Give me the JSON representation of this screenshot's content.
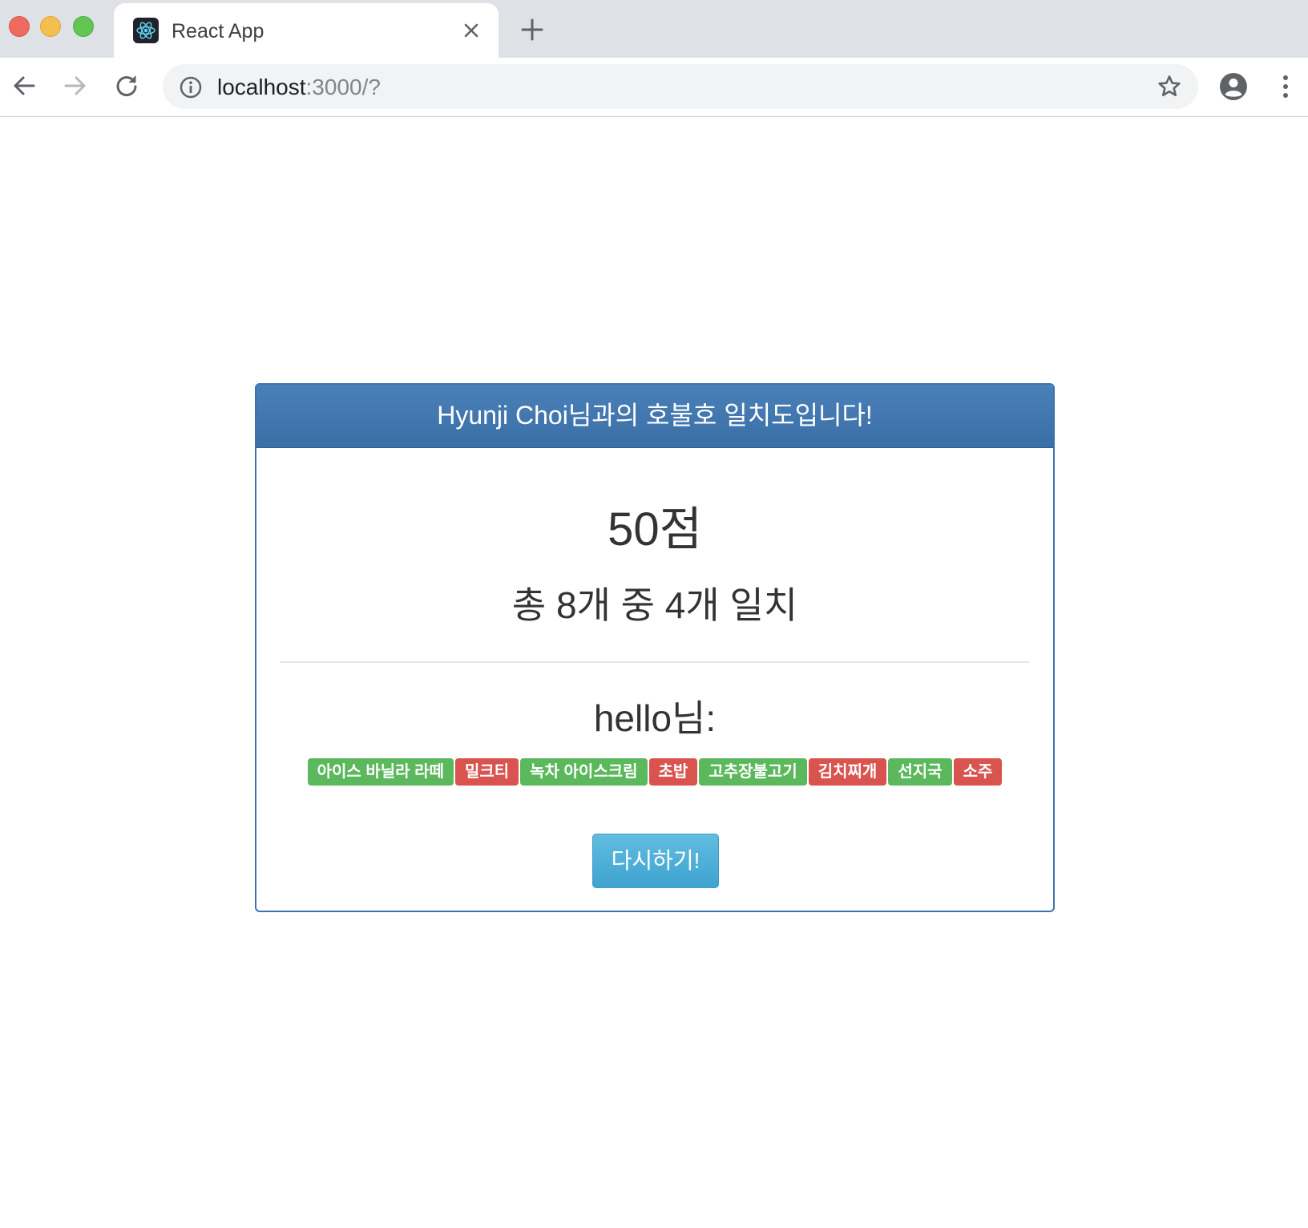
{
  "browser": {
    "tab_title": "React App",
    "url_host": "localhost",
    "url_rest": ":3000/?",
    "icons": {
      "favicon": "react-logo-icon",
      "tab_close": "close-icon",
      "new_tab": "plus-icon",
      "back": "arrow-left-icon",
      "forward": "arrow-right-icon",
      "reload": "reload-icon",
      "site_info": "info-icon",
      "bookmark": "star-icon",
      "profile": "account-icon",
      "menu": "more-vert-icon"
    }
  },
  "result": {
    "heading": "Hyunji Choi님과의 호불호 일치도입니다!",
    "score": "50점",
    "summary": "총 8개 중 4개 일치",
    "friend_label": "hello님:",
    "items": [
      {
        "text": "아이스 바닐라 라떼",
        "matched": true
      },
      {
        "text": "밀크티",
        "matched": false
      },
      {
        "text": "녹차 아이스크림",
        "matched": true
      },
      {
        "text": "초밥",
        "matched": false
      },
      {
        "text": "고추장불고기",
        "matched": true
      },
      {
        "text": "김치찌개",
        "matched": false
      },
      {
        "text": "선지국",
        "matched": true
      },
      {
        "text": "소주",
        "matched": false
      }
    ],
    "retry_label": "다시하기!"
  },
  "colors": {
    "heading_bg": "#3d73ad",
    "match": "#5cb85c",
    "mismatch": "#d9534f",
    "button": "#5bc0de"
  }
}
